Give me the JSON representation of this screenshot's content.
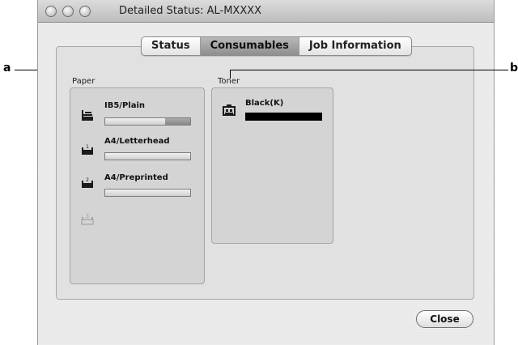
{
  "window": {
    "title": "Detailed Status: AL-MXXXX"
  },
  "tabs": [
    {
      "label": "Status",
      "active": false
    },
    {
      "label": "Consumables",
      "active": true
    },
    {
      "label": "Job Information",
      "active": false
    }
  ],
  "paper": {
    "label": "Paper",
    "trays": [
      {
        "label": "IB5/Plain",
        "level": 0.7,
        "icon": "mp-tray-icon"
      },
      {
        "label": "A4/Letterhead",
        "level": 1.0,
        "icon": "tray-1-icon",
        "tray_number": "1"
      },
      {
        "label": "A4/Preprinted",
        "level": 1.0,
        "icon": "tray-2-icon",
        "tray_number": "2"
      },
      {
        "label": "",
        "icon": "tray-3-icon",
        "tray_number": "3"
      }
    ]
  },
  "toner": {
    "label": "Toner",
    "items": [
      {
        "label": "Black(K)",
        "level": 1.0,
        "color": "#000000",
        "icon": "toner-icon"
      }
    ]
  },
  "buttons": {
    "close": "Close"
  },
  "callouts": {
    "a": "a",
    "b": "b"
  }
}
